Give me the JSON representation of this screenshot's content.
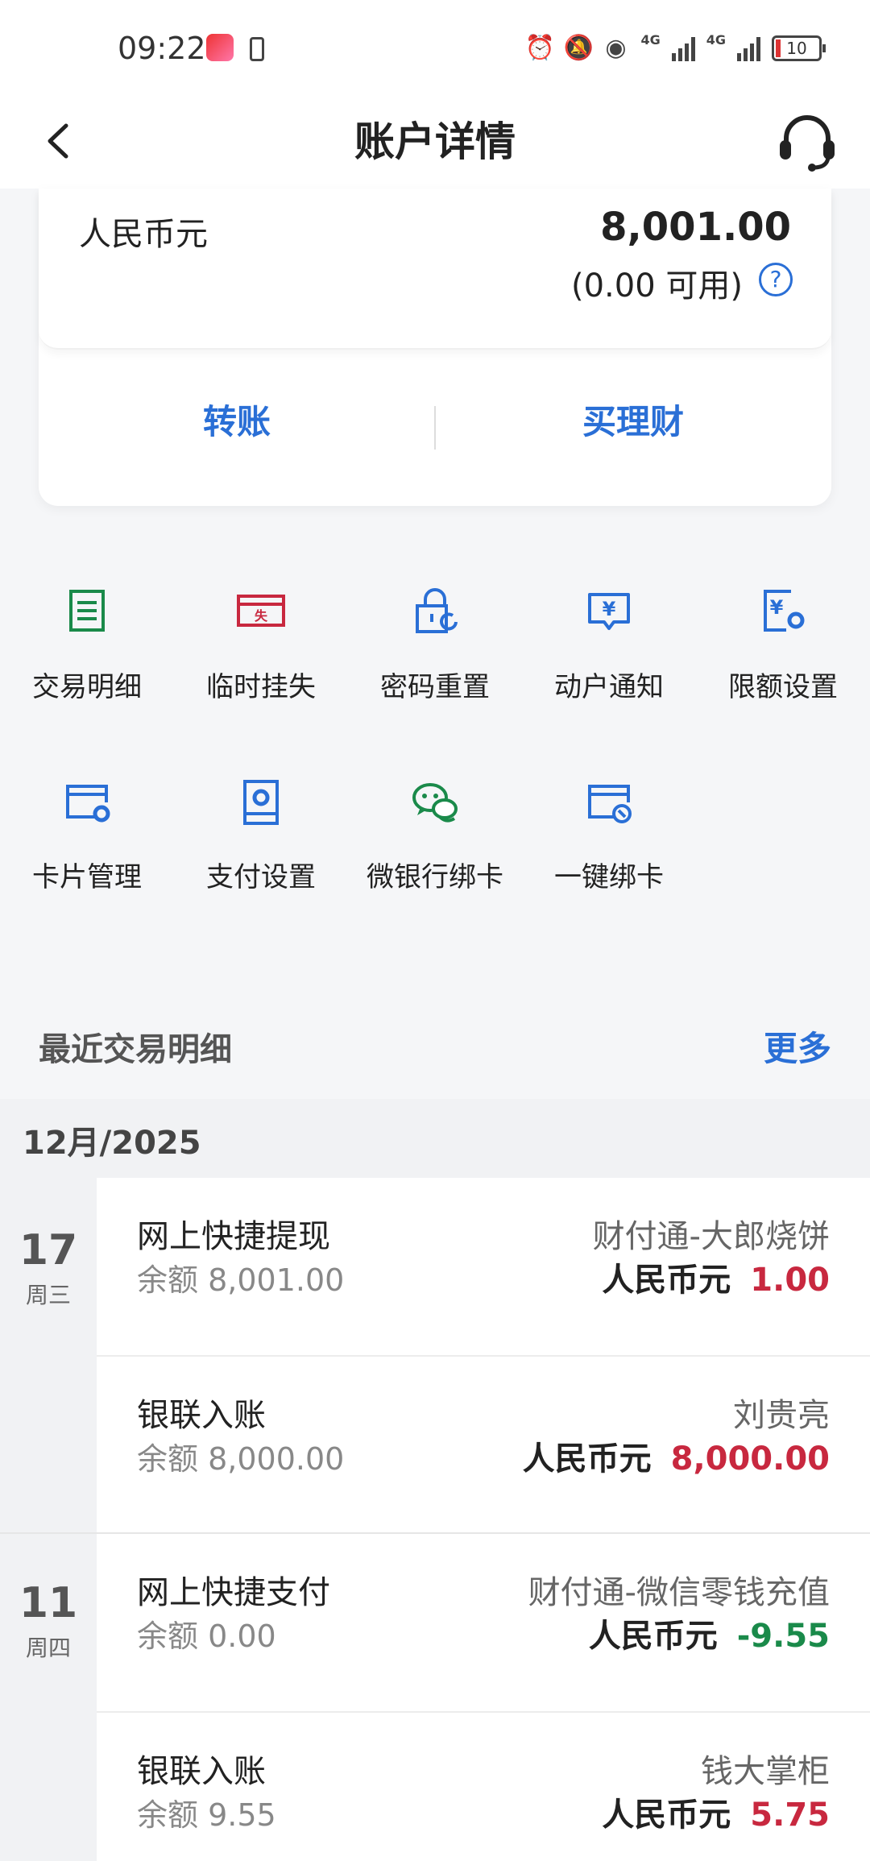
{
  "status_bar": {
    "time": "09:22",
    "battery": "10"
  },
  "header": {
    "title": "账户详情"
  },
  "account": {
    "currency": "人民币元",
    "balance": "8,001.00",
    "available": "(0.00 可用)",
    "help": "?",
    "actions": {
      "transfer": "转账",
      "buy_wealth": "买理财"
    }
  },
  "functions": [
    {
      "label": "交易明细",
      "icon": "list-icon",
      "color": "#1a8a4a"
    },
    {
      "label": "临时挂失",
      "icon": "loss-report-icon",
      "color": "#c8283f",
      "glyph": "失"
    },
    {
      "label": "密码重置",
      "icon": "lock-reset-icon",
      "color": "#2a6fd6"
    },
    {
      "label": "动户通知",
      "icon": "notice-icon",
      "color": "#2a6fd6",
      "glyph": "¥"
    },
    {
      "label": "限额设置",
      "icon": "limit-setting-icon",
      "color": "#2a6fd6",
      "glyph": "¥"
    },
    {
      "label": "卡片管理",
      "icon": "card-manage-icon",
      "color": "#2a6fd6"
    },
    {
      "label": "支付设置",
      "icon": "payment-setting-icon",
      "color": "#2a6fd6"
    },
    {
      "label": "微银行绑卡",
      "icon": "wechat-bind-icon",
      "color": "#1a8a4a"
    },
    {
      "label": "一键绑卡",
      "icon": "quick-bind-icon",
      "color": "#2a6fd6"
    }
  ],
  "recent": {
    "title": "最近交易明细",
    "more": "更多"
  },
  "month": "12月/2025",
  "days": [
    {
      "day": "17",
      "weekday": "周三"
    },
    {
      "day": "11",
      "weekday": "周四"
    }
  ],
  "transactions": [
    {
      "name": "网上快捷提现",
      "balance_label": "余额 8,001.00",
      "peer": "财付通-大郎烧饼",
      "currency": "人民币元",
      "amount": "1.00",
      "sign": "pos"
    },
    {
      "name": "银联入账",
      "balance_label": "余额 8,000.00",
      "peer": "刘贵亮",
      "currency": "人民币元",
      "amount": "8,000.00",
      "sign": "pos"
    },
    {
      "name": "网上快捷支付",
      "balance_label": "余额 0.00",
      "peer": "财付通-微信零钱充值",
      "currency": "人民币元",
      "amount": "-9.55",
      "sign": "neg"
    },
    {
      "name": "银联入账",
      "balance_label": "余额 9.55",
      "peer": "钱大掌柜",
      "currency": "人民币元",
      "amount": "5.75",
      "sign": "pos"
    }
  ]
}
